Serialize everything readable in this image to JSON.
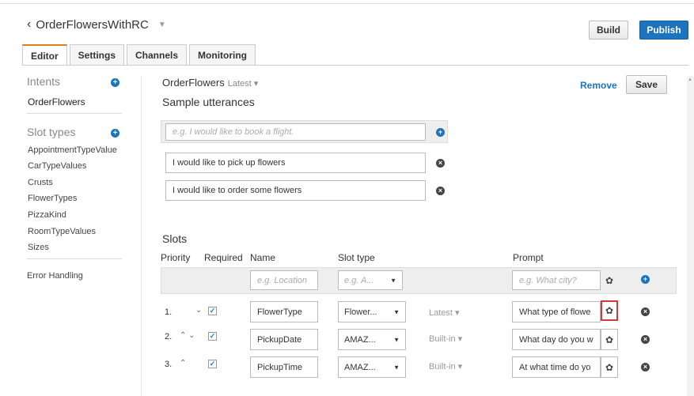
{
  "header": {
    "back_title": "OrderFlowersWithRC",
    "build_label": "Build",
    "publish_label": "Publish"
  },
  "tabs": [
    {
      "label": "Editor"
    },
    {
      "label": "Settings"
    },
    {
      "label": "Channels"
    },
    {
      "label": "Monitoring"
    }
  ],
  "sidebar": {
    "intents_heading": "Intents",
    "intents": [
      "OrderFlowers"
    ],
    "slot_types_heading": "Slot types",
    "slot_types": [
      "AppointmentTypeValue",
      "CarTypeValues",
      "Crusts",
      "FlowerTypes",
      "PizzaKind",
      "RoomTypeValues",
      "Sizes"
    ],
    "error_handling": "Error Handling"
  },
  "main": {
    "intent_name": "OrderFlowers",
    "intent_version": "Latest",
    "remove_label": "Remove",
    "save_label": "Save",
    "utterances_heading": "Sample utterances",
    "utterance_placeholder": "e.g. I would like to book a flight.",
    "utterances": [
      "I would like to pick up flowers",
      "I would like to order some flowers"
    ],
    "slots_heading": "Slots",
    "columns": {
      "priority": "Priority",
      "required": "Required",
      "name": "Name",
      "slot_type": "Slot type",
      "prompt": "Prompt"
    },
    "new_slot": {
      "name_placeholder": "e.g. Location",
      "type_placeholder": "e.g. A...",
      "prompt_placeholder": "e.g. What city?"
    },
    "slots": [
      {
        "priority": "1.",
        "arrows": "⌄",
        "name": "FlowerType",
        "type": "Flower...",
        "version": "Latest",
        "prompt": "What type of flowe"
      },
      {
        "priority": "2.",
        "arrows": "⌃ ⌄",
        "name": "PickupDate",
        "type": "AMAZ...",
        "version": "Built-in",
        "prompt": "What day do you w"
      },
      {
        "priority": "3.",
        "arrows": "⌃",
        "name": "PickupTime",
        "type": "AMAZ...",
        "version": "Built-in",
        "prompt": "At what time do yo"
      }
    ]
  }
}
